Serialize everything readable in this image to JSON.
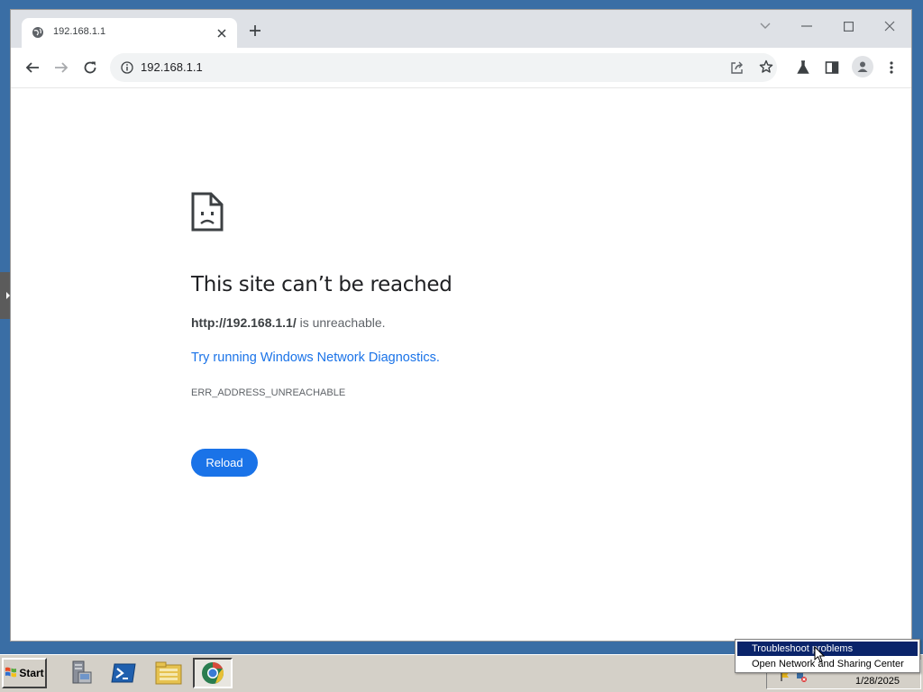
{
  "browser": {
    "tab": {
      "title": "192.168.1.1"
    },
    "address_bar": {
      "url": "192.168.1.1"
    }
  },
  "error_page": {
    "title": "This site can’t be reached",
    "url_bold": "http://192.168.1.1/",
    "url_suffix": " is unreachable.",
    "diagnostics_link": "Try running Windows Network Diagnostics.",
    "error_code": "ERR_ADDRESS_UNREACHABLE",
    "reload_label": "Reload"
  },
  "taskbar": {
    "start_label": "Start",
    "apps": [
      "server-manager-icon",
      "powershell-icon",
      "file-explorer-icon",
      "browser-icon"
    ],
    "clock_date": "1/28/2025"
  },
  "context_menu": {
    "items": [
      "Troubleshoot problems",
      "Open Network and Sharing Center"
    ]
  },
  "colors": {
    "accent": "#1a73e8",
    "desktop": "#3a6ea5",
    "menu_highlight": "#0a246a"
  }
}
